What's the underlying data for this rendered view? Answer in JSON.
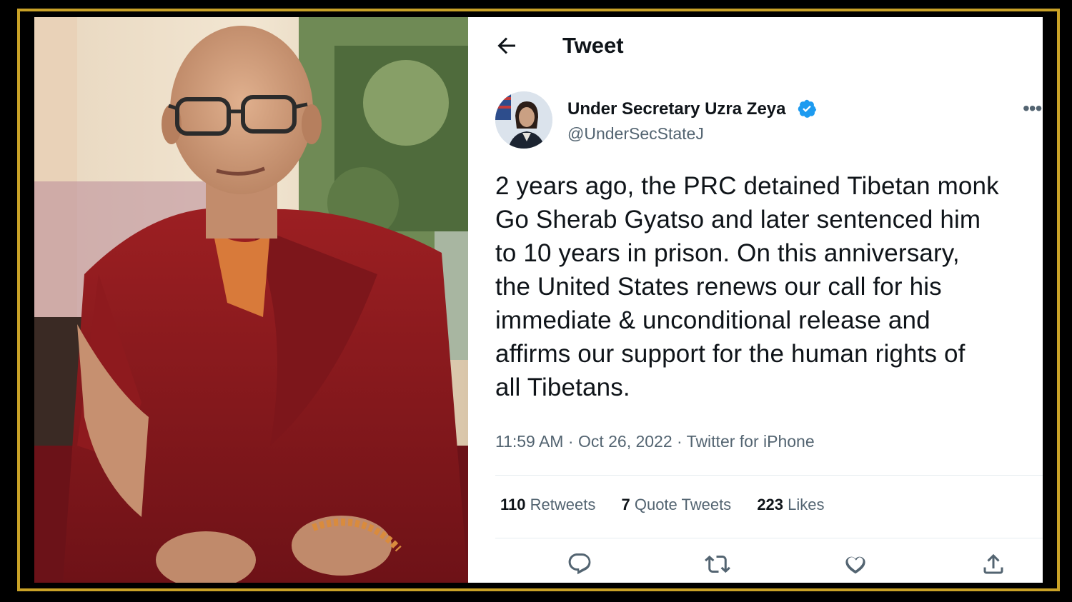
{
  "header": {
    "title": "Tweet"
  },
  "author": {
    "name": "Under Secretary Uzra Zeya",
    "handle": "@UnderSecStateJ"
  },
  "tweet": {
    "text": "2 years ago, the PRC detained Tibetan monk\nGo Sherab Gyatso and later sentenced him\nto 10 years in prison. On this anniversary,\nthe United States renews our call for his\nimmediate & unconditional release and\naffirms our support for the human rights of\nall Tibetans.",
    "time": "11:59 AM",
    "date": "Oct 26, 2022",
    "source": "Twitter for iPhone"
  },
  "stats": {
    "retweets_count": "110",
    "retweets_label": "Retweets",
    "quotes_count": "7",
    "quotes_label": "Quote Tweets",
    "likes_count": "223",
    "likes_label": "Likes"
  },
  "colors": {
    "frame": "#c9a227",
    "verified": "#1d9bf0",
    "text": "#0f1419",
    "secondary": "#536471"
  }
}
